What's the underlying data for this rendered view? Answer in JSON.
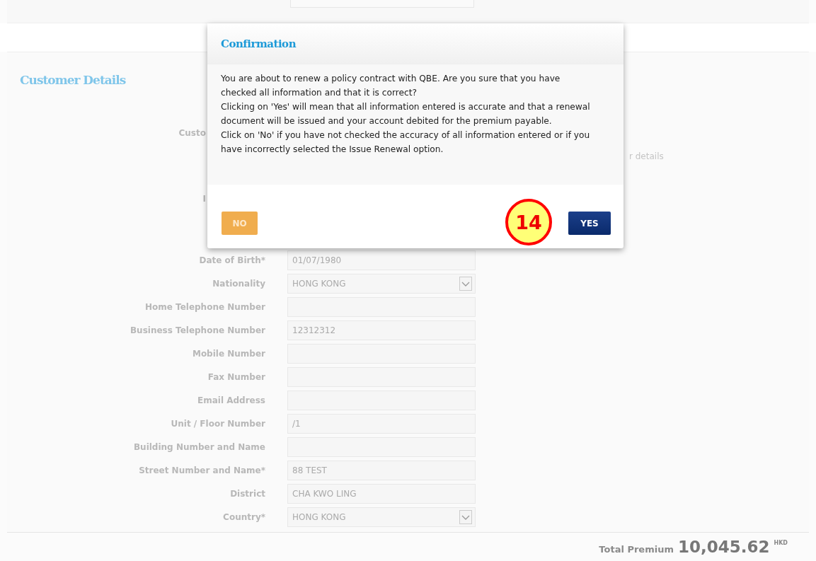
{
  "customer_details": {
    "title": "Customer Details",
    "obscured_rows": [
      {
        "label": "Custo"
      },
      {
        "hint": "r details"
      },
      {
        "label": "I"
      }
    ],
    "fields": [
      {
        "label": "Date of Birth*",
        "value": "01/07/1980",
        "kind": "text"
      },
      {
        "label": "Nationality",
        "value": "HONG KONG",
        "kind": "select"
      },
      {
        "label": "Home Telephone Number",
        "kind": "text"
      },
      {
        "label": "Business Telephone Number",
        "value": "12312312",
        "kind": "text"
      },
      {
        "label": "Mobile Number",
        "kind": "text"
      },
      {
        "label": "Fax Number",
        "kind": "text"
      },
      {
        "label": "Email Address",
        "kind": "text"
      },
      {
        "label": "Unit / Floor Number",
        "value": "/1",
        "kind": "text"
      },
      {
        "label": "Building Number and Name",
        "kind": "text"
      },
      {
        "label": "Street Number and Name*",
        "value": "88 TEST",
        "kind": "text"
      },
      {
        "label": "District",
        "value": "CHA KWO LING",
        "kind": "text"
      },
      {
        "label": "Country*",
        "value": "HONG KONG",
        "kind": "select"
      }
    ]
  },
  "total": {
    "label": "Total Premium",
    "amount": "10,045.62",
    "currency": "HKD"
  },
  "dialog": {
    "title": "Confirmation",
    "paragraphs": [
      "You are about to renew a policy contract with QBE. Are you sure that you have checked all information and that it is correct?",
      "Clicking on 'Yes' will mean that all information entered is accurate and that a renewal document will be issued and your account debited for the premium payable.",
      "Click on 'No' if you have not checked the accuracy of all information entered or if you have incorrectly selected the Issue Renewal option."
    ],
    "buttons": [
      {
        "label": "NO",
        "kind": "secondary"
      },
      {
        "label": "YES",
        "kind": "primary"
      }
    ],
    "callout": "14"
  }
}
